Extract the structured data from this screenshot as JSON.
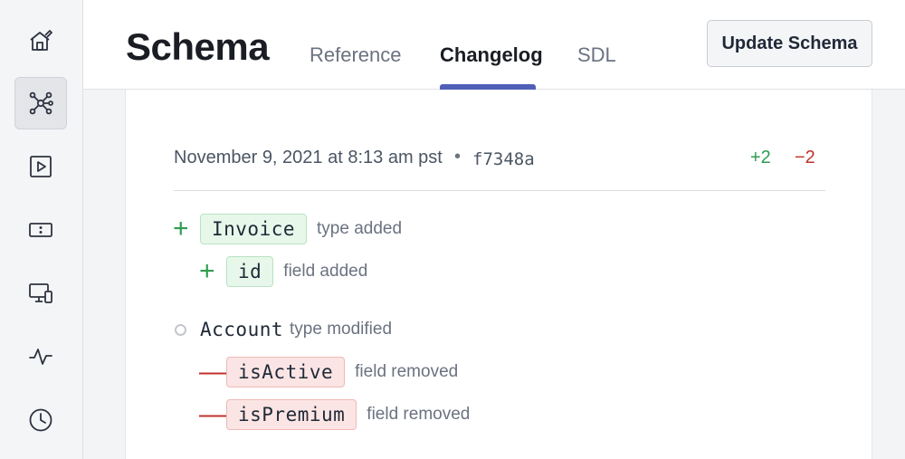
{
  "sidebar": {
    "items": [
      {
        "icon": "home-icon"
      },
      {
        "icon": "schema-graph-icon",
        "active": true
      },
      {
        "icon": "play-icon"
      },
      {
        "icon": "card-icon"
      },
      {
        "icon": "devices-icon"
      },
      {
        "icon": "activity-icon"
      },
      {
        "icon": "clock-icon"
      }
    ]
  },
  "header": {
    "title": "Schema",
    "tabs": [
      {
        "label": "Reference"
      },
      {
        "label": "Changelog",
        "active": true
      },
      {
        "label": "SDL"
      }
    ],
    "update_button": "Update Schema"
  },
  "changelog": {
    "date": "November 9, 2021 at 8:13 am pst",
    "separator": "•",
    "hash": "f7348a",
    "added_count": "+2",
    "removed_count": "−2",
    "changes": [
      {
        "kind": "added",
        "symbol": "+",
        "name": "Invoice",
        "description": "type added"
      },
      {
        "kind": "added",
        "symbol": "+",
        "name": "id",
        "description": "field added"
      },
      {
        "kind": "modified",
        "name": "Account",
        "description": "type modified"
      },
      {
        "kind": "removed",
        "symbol": "—",
        "name": "isActive",
        "description": "field removed"
      },
      {
        "kind": "removed",
        "symbol": "—",
        "name": "isPremium",
        "description": "field removed"
      }
    ]
  },
  "colors": {
    "added": "#2e9c4f",
    "removed": "#c0312c",
    "accent": "#4f5fb8"
  }
}
